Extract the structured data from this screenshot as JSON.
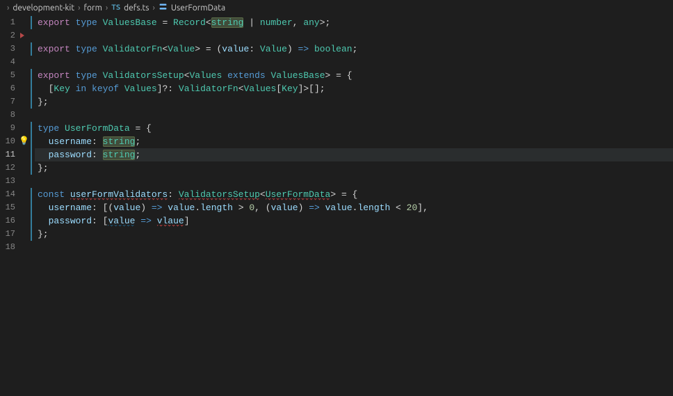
{
  "breadcrumb": {
    "items": [
      "development-kit",
      "form",
      "defs.ts",
      "UserFormData"
    ],
    "fileIcon": "TS",
    "symbolIcon": "interface-icon"
  },
  "totalLines": 18,
  "activeLine": 11,
  "triangleLine": 2,
  "bulbLine": 10,
  "foldMarkedLines": [
    1,
    3,
    5,
    6,
    7,
    9,
    10,
    11,
    12,
    14,
    15,
    16,
    17
  ],
  "code": {
    "lines": [
      {
        "n": 1,
        "tokens": [
          {
            "t": "export ",
            "c": "kw-export"
          },
          {
            "t": "type ",
            "c": "kw-type"
          },
          {
            "t": "ValuesBase",
            "c": "type-name"
          },
          {
            "t": " = ",
            "c": "op"
          },
          {
            "t": "Record",
            "c": "type-name"
          },
          {
            "t": "<",
            "c": "punct"
          },
          {
            "t": "string",
            "c": "type-name",
            "sel": true
          },
          {
            "t": " | ",
            "c": "op"
          },
          {
            "t": "number",
            "c": "type-name"
          },
          {
            "t": ", ",
            "c": "punct"
          },
          {
            "t": "any",
            "c": "type-name"
          },
          {
            "t": ">;",
            "c": "punct"
          }
        ]
      },
      {
        "n": 2,
        "tokens": []
      },
      {
        "n": 3,
        "tokens": [
          {
            "t": "export ",
            "c": "kw-export"
          },
          {
            "t": "type ",
            "c": "kw-type"
          },
          {
            "t": "ValidatorFn",
            "c": "type-name"
          },
          {
            "t": "<",
            "c": "punct"
          },
          {
            "t": "Value",
            "c": "type-param"
          },
          {
            "t": "> = (",
            "c": "punct"
          },
          {
            "t": "value",
            "c": "var"
          },
          {
            "t": ": ",
            "c": "punct"
          },
          {
            "t": "Value",
            "c": "type-param"
          },
          {
            "t": ") ",
            "c": "punct"
          },
          {
            "t": "=>",
            "c": "fn-kw"
          },
          {
            "t": " ",
            "c": "punct"
          },
          {
            "t": "boolean",
            "c": "type-name"
          },
          {
            "t": ";",
            "c": "punct"
          }
        ]
      },
      {
        "n": 4,
        "tokens": []
      },
      {
        "n": 5,
        "tokens": [
          {
            "t": "export ",
            "c": "kw-export"
          },
          {
            "t": "type ",
            "c": "kw-type"
          },
          {
            "t": "ValidatorsSetup",
            "c": "type-name"
          },
          {
            "t": "<",
            "c": "punct"
          },
          {
            "t": "Values",
            "c": "type-param"
          },
          {
            "t": " ",
            "c": "punct"
          },
          {
            "t": "extends",
            "c": "kw-extends"
          },
          {
            "t": " ",
            "c": "punct"
          },
          {
            "t": "ValuesBase",
            "c": "type-name"
          },
          {
            "t": "> = {",
            "c": "punct"
          }
        ]
      },
      {
        "n": 6,
        "tokens": [
          {
            "t": "  [",
            "c": "punct"
          },
          {
            "t": "Key",
            "c": "type-param"
          },
          {
            "t": " ",
            "c": "punct"
          },
          {
            "t": "in",
            "c": "kw-in"
          },
          {
            "t": " ",
            "c": "punct"
          },
          {
            "t": "keyof",
            "c": "kw-keyof"
          },
          {
            "t": " ",
            "c": "punct"
          },
          {
            "t": "Values",
            "c": "type-param"
          },
          {
            "t": "]?: ",
            "c": "punct"
          },
          {
            "t": "ValidatorFn",
            "c": "type-name"
          },
          {
            "t": "<",
            "c": "punct"
          },
          {
            "t": "Values",
            "c": "type-param"
          },
          {
            "t": "[",
            "c": "punct"
          },
          {
            "t": "Key",
            "c": "type-param"
          },
          {
            "t": "]>[];",
            "c": "punct"
          }
        ]
      },
      {
        "n": 7,
        "tokens": [
          {
            "t": "};",
            "c": "punct"
          }
        ]
      },
      {
        "n": 8,
        "tokens": []
      },
      {
        "n": 9,
        "tokens": [
          {
            "t": "type ",
            "c": "kw-type"
          },
          {
            "t": "UserFormData",
            "c": "type-name"
          },
          {
            "t": " = {",
            "c": "punct"
          }
        ]
      },
      {
        "n": 10,
        "tokens": [
          {
            "t": "  ",
            "c": "punct"
          },
          {
            "t": "username",
            "c": "prop"
          },
          {
            "t": ": ",
            "c": "punct"
          },
          {
            "t": "string",
            "c": "type-name",
            "sel": true
          },
          {
            "t": ";",
            "c": "punct"
          }
        ]
      },
      {
        "n": 11,
        "tokens": [
          {
            "t": "  ",
            "c": "punct"
          },
          {
            "t": "password",
            "c": "prop"
          },
          {
            "t": ": ",
            "c": "punct"
          },
          {
            "t": "string",
            "c": "type-name",
            "sel": true
          },
          {
            "t": ";",
            "c": "punct"
          }
        ]
      },
      {
        "n": 12,
        "tokens": [
          {
            "t": "};",
            "c": "punct"
          }
        ]
      },
      {
        "n": 13,
        "tokens": []
      },
      {
        "n": 14,
        "tokens": [
          {
            "t": "const ",
            "c": "kw-const"
          },
          {
            "t": "userFormValidators",
            "c": "var",
            "err": true
          },
          {
            "t": ": ",
            "c": "punct"
          },
          {
            "t": "ValidatorsSetup",
            "c": "type-name",
            "err": true
          },
          {
            "t": "<",
            "c": "punct"
          },
          {
            "t": "UserFormData",
            "c": "type-name",
            "err": true
          },
          {
            "t": ">",
            "c": "punct"
          },
          {
            "t": " = {",
            "c": "punct"
          }
        ]
      },
      {
        "n": 15,
        "tokens": [
          {
            "t": "  ",
            "c": "punct"
          },
          {
            "t": "username",
            "c": "prop"
          },
          {
            "t": ": [(",
            "c": "punct"
          },
          {
            "t": "value",
            "c": "var"
          },
          {
            "t": ") ",
            "c": "punct"
          },
          {
            "t": "=>",
            "c": "fn-kw"
          },
          {
            "t": " ",
            "c": "punct"
          },
          {
            "t": "value",
            "c": "var"
          },
          {
            "t": ".",
            "c": "punct"
          },
          {
            "t": "length",
            "c": "prop"
          },
          {
            "t": " > ",
            "c": "op"
          },
          {
            "t": "0",
            "c": "num"
          },
          {
            "t": ", (",
            "c": "punct"
          },
          {
            "t": "value",
            "c": "var"
          },
          {
            "t": ") ",
            "c": "punct"
          },
          {
            "t": "=>",
            "c": "fn-kw"
          },
          {
            "t": " ",
            "c": "punct"
          },
          {
            "t": "value",
            "c": "var"
          },
          {
            "t": ".",
            "c": "punct"
          },
          {
            "t": "length",
            "c": "prop"
          },
          {
            "t": " < ",
            "c": "op"
          },
          {
            "t": "20",
            "c": "num"
          },
          {
            "t": "],",
            "c": "punct"
          }
        ]
      },
      {
        "n": 16,
        "tokens": [
          {
            "t": "  ",
            "c": "punct"
          },
          {
            "t": "password",
            "c": "prop"
          },
          {
            "t": ": [",
            "c": "punct"
          },
          {
            "t": "value",
            "c": "var",
            "warn": true
          },
          {
            "t": " ",
            "c": "punct"
          },
          {
            "t": "=>",
            "c": "fn-kw"
          },
          {
            "t": " ",
            "c": "punct"
          },
          {
            "t": "vlaue",
            "c": "var",
            "err": true
          },
          {
            "t": "]",
            "c": "punct"
          }
        ]
      },
      {
        "n": 17,
        "tokens": [
          {
            "t": "};",
            "c": "punct"
          }
        ]
      },
      {
        "n": 18,
        "tokens": []
      }
    ]
  }
}
